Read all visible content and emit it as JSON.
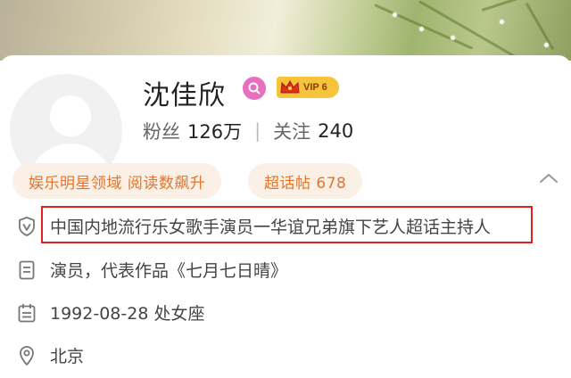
{
  "profile": {
    "name": "沈佳欣",
    "vip_label": "VIP 6",
    "fans_label": "粉丝",
    "fans_count": "126万",
    "follow_label": "关注",
    "follow_count": "240"
  },
  "tags": {
    "domain": "娱乐明星领域 阅读数飙升",
    "super_topic": "超话帖 678"
  },
  "info": {
    "verification": "中国内地流行乐女歌手演员一华谊兄弟旗下艺人超话主持人",
    "intro": "演员，代表作品《七月七日晴》",
    "birthday": "1992-08-28 处女座",
    "location": "北京"
  },
  "colors": {
    "accent_orange": "#e5742b",
    "verified_gold": "#f5b400",
    "vip_gold": "#f6c33a",
    "highlight_red": "#e0211f"
  },
  "icons": [
    "search-badge-icon",
    "crown-icon",
    "verified-v-icon",
    "chevron-up-icon",
    "shield-v-icon",
    "document-icon",
    "calendar-icon",
    "location-pin-icon"
  ]
}
